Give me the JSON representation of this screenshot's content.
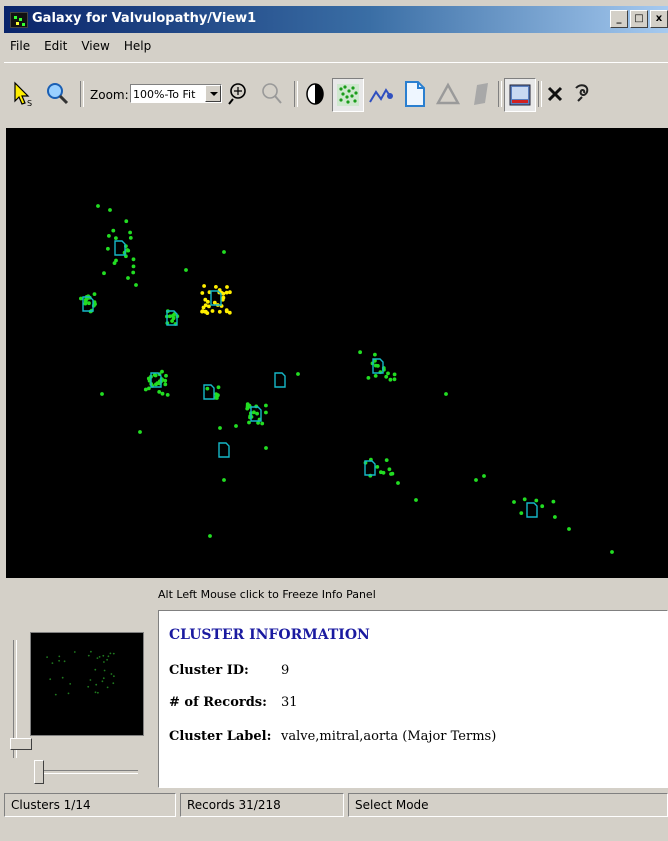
{
  "window": {
    "title": "Galaxy for Valvulopathy/View1",
    "controls": [
      "_",
      "□",
      "x"
    ]
  },
  "menu": [
    "File",
    "Edit",
    "View",
    "Help"
  ],
  "toolbar": {
    "zoom_label": "Zoom:",
    "zoom_value": "100%-To Fit",
    "tools": [
      "select-tool",
      "zoom-lens-tool",
      "zoom-in-tool",
      "zoom-out-tool",
      "contrast-tool",
      "galaxy-view-tool",
      "themeview-tool",
      "document-tool",
      "triangle-tool",
      "flag-tool",
      "screen-tool",
      "clear-tool",
      "undo-tool"
    ]
  },
  "canvas": {
    "colors": {
      "background": "#000000",
      "points": "#22dd22",
      "selected_points": "#ffee00",
      "centroids": "#16b8c8"
    }
  },
  "hint_text": "Alt Left Mouse click to Freeze Info Panel",
  "info": {
    "heading": "CLUSTER INFORMATION",
    "cluster_id_label": "Cluster ID:",
    "cluster_id": "9",
    "records_label": "# of Records:",
    "records": "31",
    "cluster_label_label": "Cluster Label:",
    "cluster_label": "valve,mitral,aorta (Major Terms)"
  },
  "status": {
    "clusters": "Clusters 1/14",
    "records": "Records 31/218",
    "mode": "Select Mode"
  }
}
